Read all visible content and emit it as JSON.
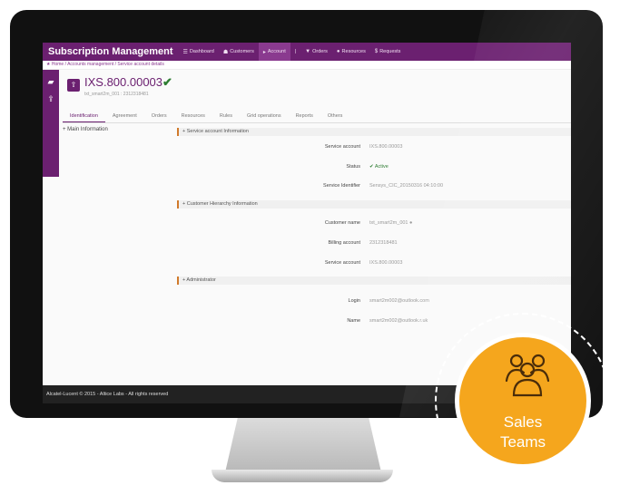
{
  "app": {
    "title": "Subscription Management"
  },
  "nav": [
    {
      "icon": "☰",
      "label": "Dashboard"
    },
    {
      "icon": "☗",
      "label": "Customers"
    },
    {
      "icon": "▸",
      "label": "Account",
      "active": true
    },
    {
      "icon": "",
      "label": "|"
    },
    {
      "icon": "▼",
      "label": "Orders"
    },
    {
      "icon": "●",
      "label": "Resources"
    },
    {
      "icon": "$",
      "label": "Requests"
    }
  ],
  "breadcrumb": "★ Home / Accounts management / Service account details",
  "account": {
    "id": "IXS.800.00003",
    "sub": "txt_smart2m_001 : 2312318481"
  },
  "tabs": [
    "Identification",
    "Agreement",
    "Orders",
    "Resources",
    "Rules",
    "Grid operations",
    "Reports",
    "Others"
  ],
  "left_title": "+ Main Information",
  "sections": {
    "service": "+ Service account Information",
    "customer": "+ Customer Hierarchy Information",
    "admin": "+ Administrator"
  },
  "fields": [
    {
      "label": "Service account",
      "value": "IXS.800.00003"
    },
    {
      "label": "Status",
      "value": "✔ Active"
    },
    {
      "label": "Service Identifier",
      "value": "Sensys_CIC_20150316 04:10:00"
    },
    {
      "label": "Customer name",
      "value": "txt_smart2m_001 ●"
    },
    {
      "label": "Billing account",
      "value": "2312318481"
    },
    {
      "label": "Service account",
      "value": "IXS.800.00003"
    },
    {
      "label": "Login",
      "value": "smart2m002@outlook.com"
    },
    {
      "label": "Name",
      "value": "smart2m002@outlook.r.uk"
    }
  ],
  "footer": "Alcatel-Lucent  © 2015 - Altice Labs - All rights reserved",
  "badge": {
    "line1": "Sales",
    "line2": "Teams",
    "icon": "team-icon",
    "color": "#f5a61d"
  }
}
